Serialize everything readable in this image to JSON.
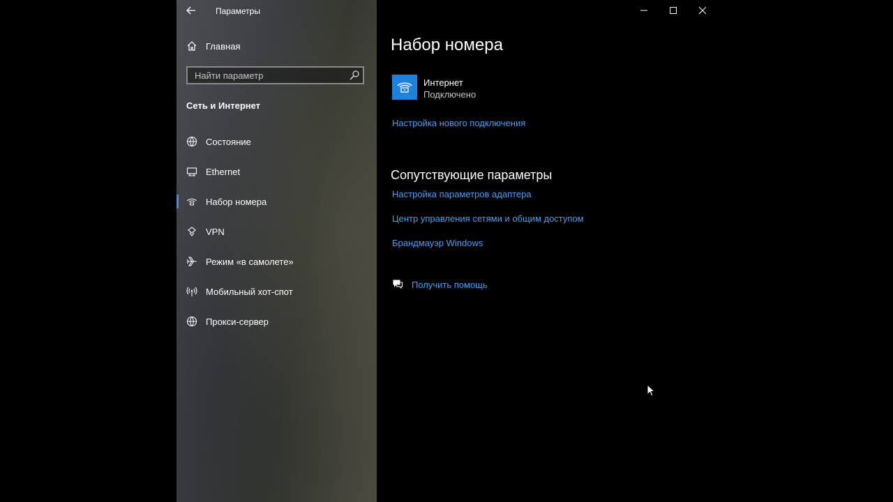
{
  "app": {
    "title": "Параметры"
  },
  "sidebar": {
    "home_label": "Главная",
    "search_placeholder": "Найти параметр",
    "section_title": "Сеть и Интернет",
    "items": [
      {
        "label": "Состояние",
        "icon": "globe-status-icon",
        "active": false
      },
      {
        "label": "Ethernet",
        "icon": "ethernet-icon",
        "active": false
      },
      {
        "label": "Набор номера",
        "icon": "dialup-icon",
        "active": true
      },
      {
        "label": "VPN",
        "icon": "vpn-icon",
        "active": false
      },
      {
        "label": "Режим «в самолете»",
        "icon": "airplane-icon",
        "active": false
      },
      {
        "label": "Мобильный хот-спот",
        "icon": "hotspot-icon",
        "active": false
      },
      {
        "label": "Прокси-сервер",
        "icon": "globe-icon",
        "active": false
      }
    ]
  },
  "main": {
    "title": "Набор номера",
    "connection": {
      "name": "Интернет",
      "status": "Подключено",
      "icon": "phone-icon"
    },
    "setup_link": "Настройка нового подключения",
    "related_title": "Сопутствующие параметры",
    "related_links": [
      "Настройка параметров адаптера",
      "Центр управления сетями и общим доступом",
      "Брандмауэр Windows"
    ],
    "help_link": "Получить помощь"
  },
  "colors": {
    "accent": "#1e82dc",
    "link": "#4a9ff0",
    "selection_bar": "#3a8ee6"
  }
}
